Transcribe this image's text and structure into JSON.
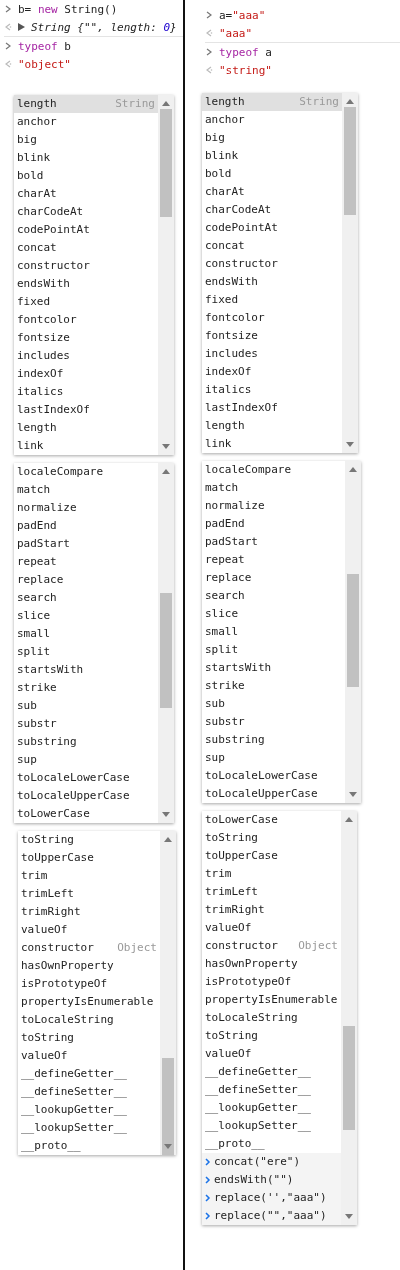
{
  "columns": [
    {
      "console": [
        {
          "kind": "input",
          "tokens": [
            {
              "text": "b= ",
              "kind": "plain"
            },
            {
              "text": "new",
              "kind": "keyword"
            },
            {
              "text": " String()",
              "kind": "plain"
            }
          ]
        },
        {
          "kind": "output",
          "expandable": true,
          "tokens": [
            {
              "text": "String {\"\", length: ",
              "kind": "italic"
            },
            {
              "text": "0",
              "kind": "number"
            },
            {
              "text": "}",
              "kind": "italic"
            }
          ]
        },
        {
          "kind": "input",
          "tokens": [
            {
              "text": "typeof",
              "kind": "keyword"
            },
            {
              "text": " b",
              "kind": "plain"
            }
          ]
        },
        {
          "kind": "output",
          "expandable": false,
          "tokens": [
            {
              "text": "\"object\"",
              "kind": "string"
            }
          ]
        }
      ],
      "popups": [
        {
          "items": [
            {
              "label": "length",
              "type": "String",
              "selected": true
            },
            {
              "label": "anchor",
              "selected": false
            },
            {
              "label": "big",
              "selected": false
            },
            {
              "label": "blink",
              "selected": false
            },
            {
              "label": "bold",
              "selected": false
            },
            {
              "label": "charAt",
              "selected": false
            },
            {
              "label": "charCodeAt",
              "selected": false
            },
            {
              "label": "codePointAt",
              "selected": false
            },
            {
              "label": "concat",
              "selected": false
            },
            {
              "label": "constructor",
              "selected": false
            },
            {
              "label": "endsWith",
              "selected": false
            },
            {
              "label": "fixed",
              "selected": false
            },
            {
              "label": "fontcolor",
              "selected": false
            },
            {
              "label": "fontsize",
              "selected": false
            },
            {
              "label": "includes",
              "selected": false
            },
            {
              "label": "indexOf",
              "selected": false
            },
            {
              "label": "italics",
              "selected": false
            },
            {
              "label": "lastIndexOf",
              "selected": false
            },
            {
              "label": "length",
              "selected": false
            },
            {
              "label": "link",
              "selected": false
            }
          ]
        },
        {
          "items": [
            {
              "label": "localeCompare",
              "selected": false
            },
            {
              "label": "match",
              "selected": false
            },
            {
              "label": "normalize",
              "selected": false
            },
            {
              "label": "padEnd",
              "selected": false
            },
            {
              "label": "padStart",
              "selected": false
            },
            {
              "label": "repeat",
              "selected": false
            },
            {
              "label": "replace",
              "selected": false
            },
            {
              "label": "search",
              "selected": false
            },
            {
              "label": "slice",
              "selected": false
            },
            {
              "label": "small",
              "selected": false
            },
            {
              "label": "split",
              "selected": false
            },
            {
              "label": "startsWith",
              "selected": false
            },
            {
              "label": "strike",
              "selected": false
            },
            {
              "label": "sub",
              "selected": false
            },
            {
              "label": "substr",
              "selected": false
            },
            {
              "label": "substring",
              "selected": false
            },
            {
              "label": "sup",
              "selected": false
            },
            {
              "label": "toLocaleLowerCase",
              "selected": false
            },
            {
              "label": "toLocaleUpperCase",
              "selected": false
            },
            {
              "label": "toLowerCase",
              "selected": false
            }
          ]
        },
        {
          "items": [
            {
              "label": "toString",
              "selected": false
            },
            {
              "label": "toUpperCase",
              "selected": false
            },
            {
              "label": "trim",
              "selected": false
            },
            {
              "label": "trimLeft",
              "selected": false
            },
            {
              "label": "trimRight",
              "selected": false
            },
            {
              "label": "valueOf",
              "selected": false
            },
            {
              "label": "constructor",
              "type": "Object",
              "selected": false
            },
            {
              "label": "hasOwnProperty",
              "selected": false
            },
            {
              "label": "isPrototypeOf",
              "selected": false
            },
            {
              "label": "propertyIsEnumerable",
              "selected": false
            },
            {
              "label": "toLocaleString",
              "selected": false
            },
            {
              "label": "toString",
              "selected": false
            },
            {
              "label": "valueOf",
              "selected": false
            },
            {
              "label": "__defineGetter__",
              "selected": false
            },
            {
              "label": "__defineSetter__",
              "selected": false
            },
            {
              "label": "__lookupGetter__",
              "selected": false
            },
            {
              "label": "__lookupSetter__",
              "selected": false
            },
            {
              "label": "__proto__",
              "selected": false
            }
          ]
        }
      ]
    },
    {
      "console": [
        {
          "kind": "input",
          "tokens": [
            {
              "text": "a=",
              "kind": "plain"
            },
            {
              "text": "\"aaa\"",
              "kind": "string"
            }
          ]
        },
        {
          "kind": "output",
          "expandable": false,
          "tokens": [
            {
              "text": "\"aaa\"",
              "kind": "string"
            }
          ]
        },
        {
          "kind": "input",
          "tokens": [
            {
              "text": "typeof",
              "kind": "keyword"
            },
            {
              "text": " a",
              "kind": "plain"
            }
          ]
        },
        {
          "kind": "output",
          "expandable": false,
          "tokens": [
            {
              "text": "\"string\"",
              "kind": "string"
            }
          ]
        }
      ],
      "popups": [
        {
          "items": [
            {
              "label": "length",
              "type": "String",
              "selected": true
            },
            {
              "label": "anchor",
              "selected": false
            },
            {
              "label": "big",
              "selected": false
            },
            {
              "label": "blink",
              "selected": false
            },
            {
              "label": "bold",
              "selected": false
            },
            {
              "label": "charAt",
              "selected": false
            },
            {
              "label": "charCodeAt",
              "selected": false
            },
            {
              "label": "codePointAt",
              "selected": false
            },
            {
              "label": "concat",
              "selected": false
            },
            {
              "label": "constructor",
              "selected": false
            },
            {
              "label": "endsWith",
              "selected": false
            },
            {
              "label": "fixed",
              "selected": false
            },
            {
              "label": "fontcolor",
              "selected": false
            },
            {
              "label": "fontsize",
              "selected": false
            },
            {
              "label": "includes",
              "selected": false
            },
            {
              "label": "indexOf",
              "selected": false
            },
            {
              "label": "italics",
              "selected": false
            },
            {
              "label": "lastIndexOf",
              "selected": false
            },
            {
              "label": "length",
              "selected": false
            },
            {
              "label": "link",
              "selected": false
            }
          ]
        },
        {
          "items": [
            {
              "label": "localeCompare",
              "selected": false
            },
            {
              "label": "match",
              "selected": false
            },
            {
              "label": "normalize",
              "selected": false
            },
            {
              "label": "padEnd",
              "selected": false
            },
            {
              "label": "padStart",
              "selected": false
            },
            {
              "label": "repeat",
              "selected": false
            },
            {
              "label": "replace",
              "selected": false
            },
            {
              "label": "search",
              "selected": false
            },
            {
              "label": "slice",
              "selected": false
            },
            {
              "label": "small",
              "selected": false
            },
            {
              "label": "split",
              "selected": false
            },
            {
              "label": "startsWith",
              "selected": false
            },
            {
              "label": "strike",
              "selected": false
            },
            {
              "label": "sub",
              "selected": false
            },
            {
              "label": "substr",
              "selected": false
            },
            {
              "label": "substring",
              "selected": false
            },
            {
              "label": "sup",
              "selected": false
            },
            {
              "label": "toLocaleLowerCase",
              "selected": false
            },
            {
              "label": "toLocaleUpperCase",
              "selected": false
            }
          ]
        },
        {
          "items": [
            {
              "label": "toLowerCase",
              "selected": false
            },
            {
              "label": "toString",
              "selected": false
            },
            {
              "label": "toUpperCase",
              "selected": false
            },
            {
              "label": "trim",
              "selected": false
            },
            {
              "label": "trimLeft",
              "selected": false
            },
            {
              "label": "trimRight",
              "selected": false
            },
            {
              "label": "valueOf",
              "selected": false
            },
            {
              "label": "constructor",
              "type": "Object",
              "selected": false
            },
            {
              "label": "hasOwnProperty",
              "selected": false
            },
            {
              "label": "isPrototypeOf",
              "selected": false
            },
            {
              "label": "propertyIsEnumerable",
              "selected": false
            },
            {
              "label": "toLocaleString",
              "selected": false
            },
            {
              "label": "toString",
              "selected": false
            },
            {
              "label": "valueOf",
              "selected": false
            },
            {
              "label": "__defineGetter__",
              "selected": false
            },
            {
              "label": "__defineSetter__",
              "selected": false
            },
            {
              "label": "__lookupGetter__",
              "selected": false
            },
            {
              "label": "__lookupSetter__",
              "selected": false
            },
            {
              "label": "__proto__",
              "selected": false
            }
          ],
          "history": [
            "concat(\"ere\")",
            "endsWith(\"\")",
            "replace('',\"aaa\")",
            "replace(\"\",\"aaa\")"
          ]
        }
      ]
    }
  ]
}
